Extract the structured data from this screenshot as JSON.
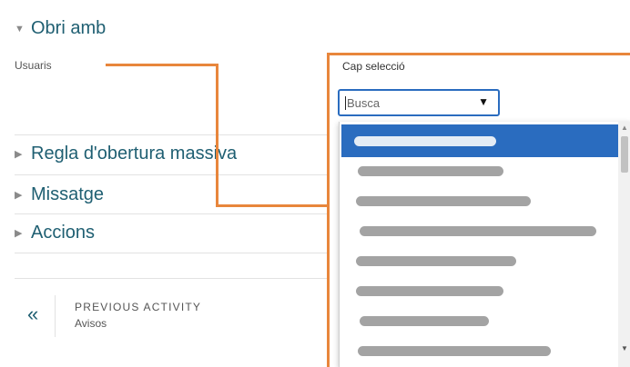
{
  "sections": {
    "open_with": {
      "label": "Obri amb",
      "expanded": true,
      "icon": "triangle-down-icon"
    },
    "mass_rule": {
      "label": "Regla d'obertura massiva",
      "expanded": false,
      "icon": "triangle-right-icon"
    },
    "message": {
      "label": "Missatge",
      "expanded": false,
      "icon": "triangle-right-icon"
    },
    "actions": {
      "label": "Accions",
      "expanded": false,
      "icon": "triangle-right-icon"
    }
  },
  "users_label": "Usuaris",
  "select_panel": {
    "current_selection": "Cap selecció",
    "search_placeholder": "Busca",
    "options_note": "blurred user names",
    "selected_color": "#2a6cbf"
  },
  "previous_activity": {
    "arrow": "«",
    "title": "PREVIOUS ACTIVITY",
    "name": "Avisos"
  },
  "colors": {
    "heading": "#1f5f72",
    "annotation": "#e8863c"
  }
}
